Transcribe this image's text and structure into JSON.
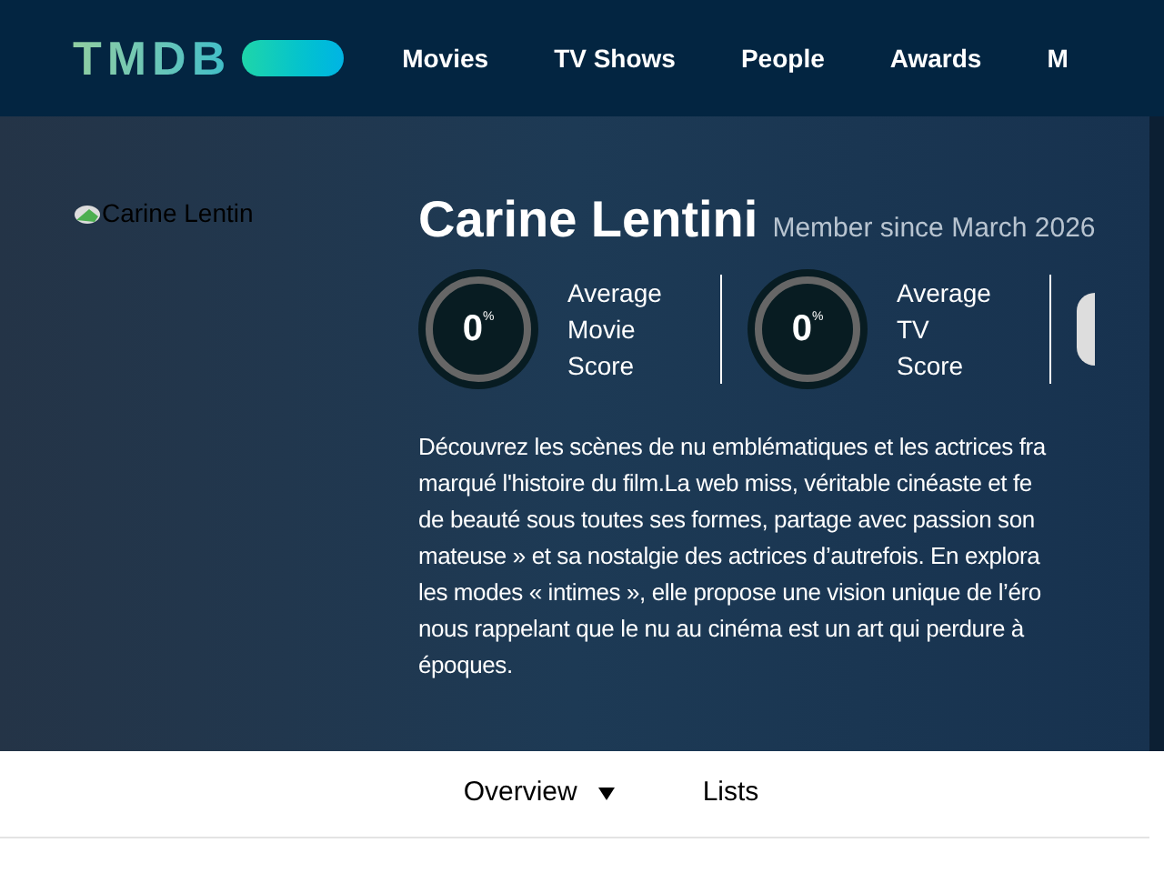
{
  "header": {
    "logo": "TMDB",
    "nav": [
      "Movies",
      "TV Shows",
      "People",
      "Awards",
      "M"
    ]
  },
  "profile": {
    "avatar_alt": "Carine Lentin",
    "name": "Carine Lentini",
    "member_since": "Member since March 2026",
    "stats": [
      {
        "score": "0",
        "unit": "%",
        "label": [
          "Average",
          "Movie",
          "Score"
        ]
      },
      {
        "score": "0",
        "unit": "%",
        "label": [
          "Average",
          "TV",
          "Score"
        ]
      }
    ],
    "bio_lines": [
      "Découvrez les scènes de nu emblématiques et les actrices fra",
      "marqué l'histoire du film.La web miss, véritable cinéaste et fe",
      "de beauté sous toutes ses formes, partage avec passion son",
      "mateuse » et sa nostalgie des actrices d’autrefois. En explora",
      "les modes « intimes », elle propose une vision unique de l’éro",
      "nous rappelant que le nu au cinéma est un art qui perdure à",
      "époques."
    ]
  },
  "tabs": [
    {
      "label": "Overview",
      "dropdown": true
    },
    {
      "label": "Lists",
      "dropdown": false
    }
  ]
}
